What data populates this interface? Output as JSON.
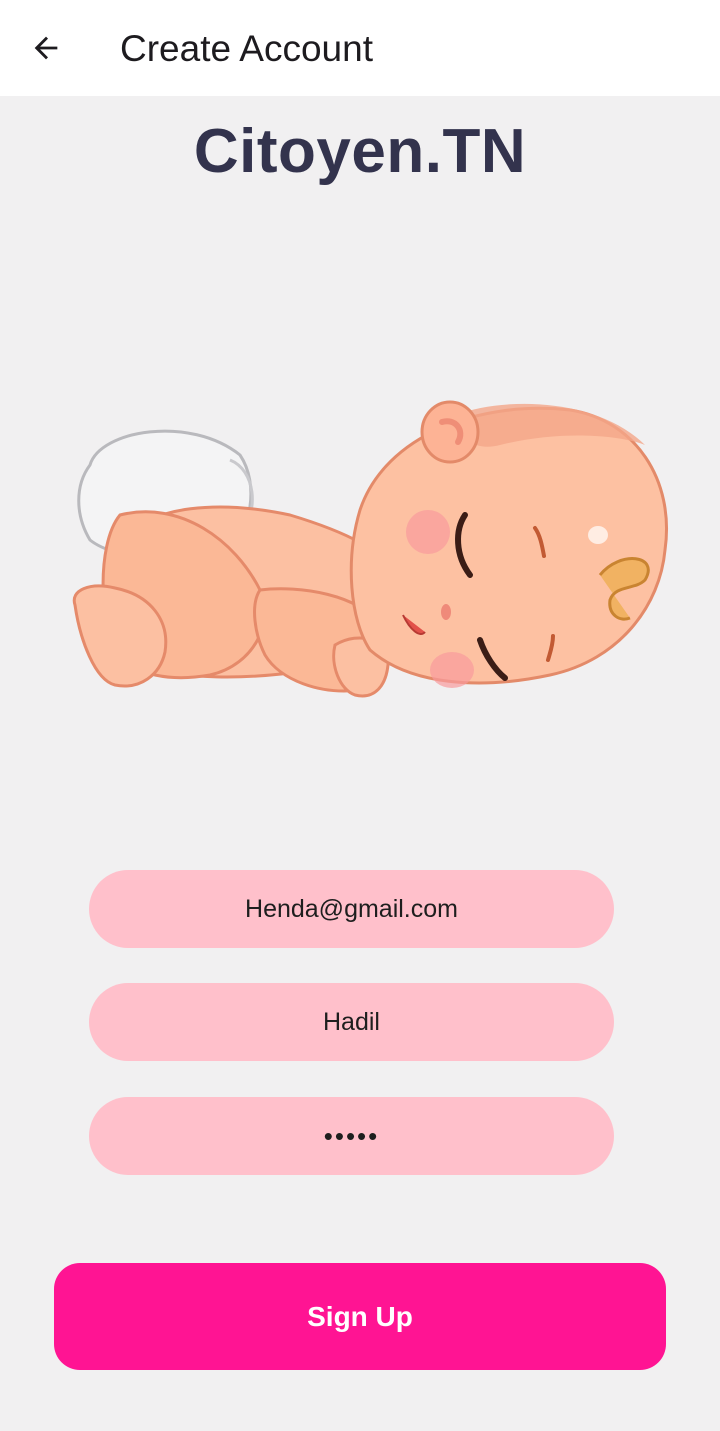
{
  "appbar": {
    "title": "Create Account",
    "back_icon": "arrow-left-icon"
  },
  "brand": {
    "name": "Citoyen.TN"
  },
  "illustration": {
    "subject": "sleeping-baby-illustration"
  },
  "form": {
    "email_value": "Henda@gmail.com",
    "name_value": "Hadil",
    "password_value": "•••••"
  },
  "actions": {
    "signup_label": "Sign Up"
  },
  "colors": {
    "background": "#f1f0f1",
    "appbar": "#ffffff",
    "field": "#ffc0cb",
    "primary": "#ff1493",
    "brand_text": "#33334d"
  }
}
